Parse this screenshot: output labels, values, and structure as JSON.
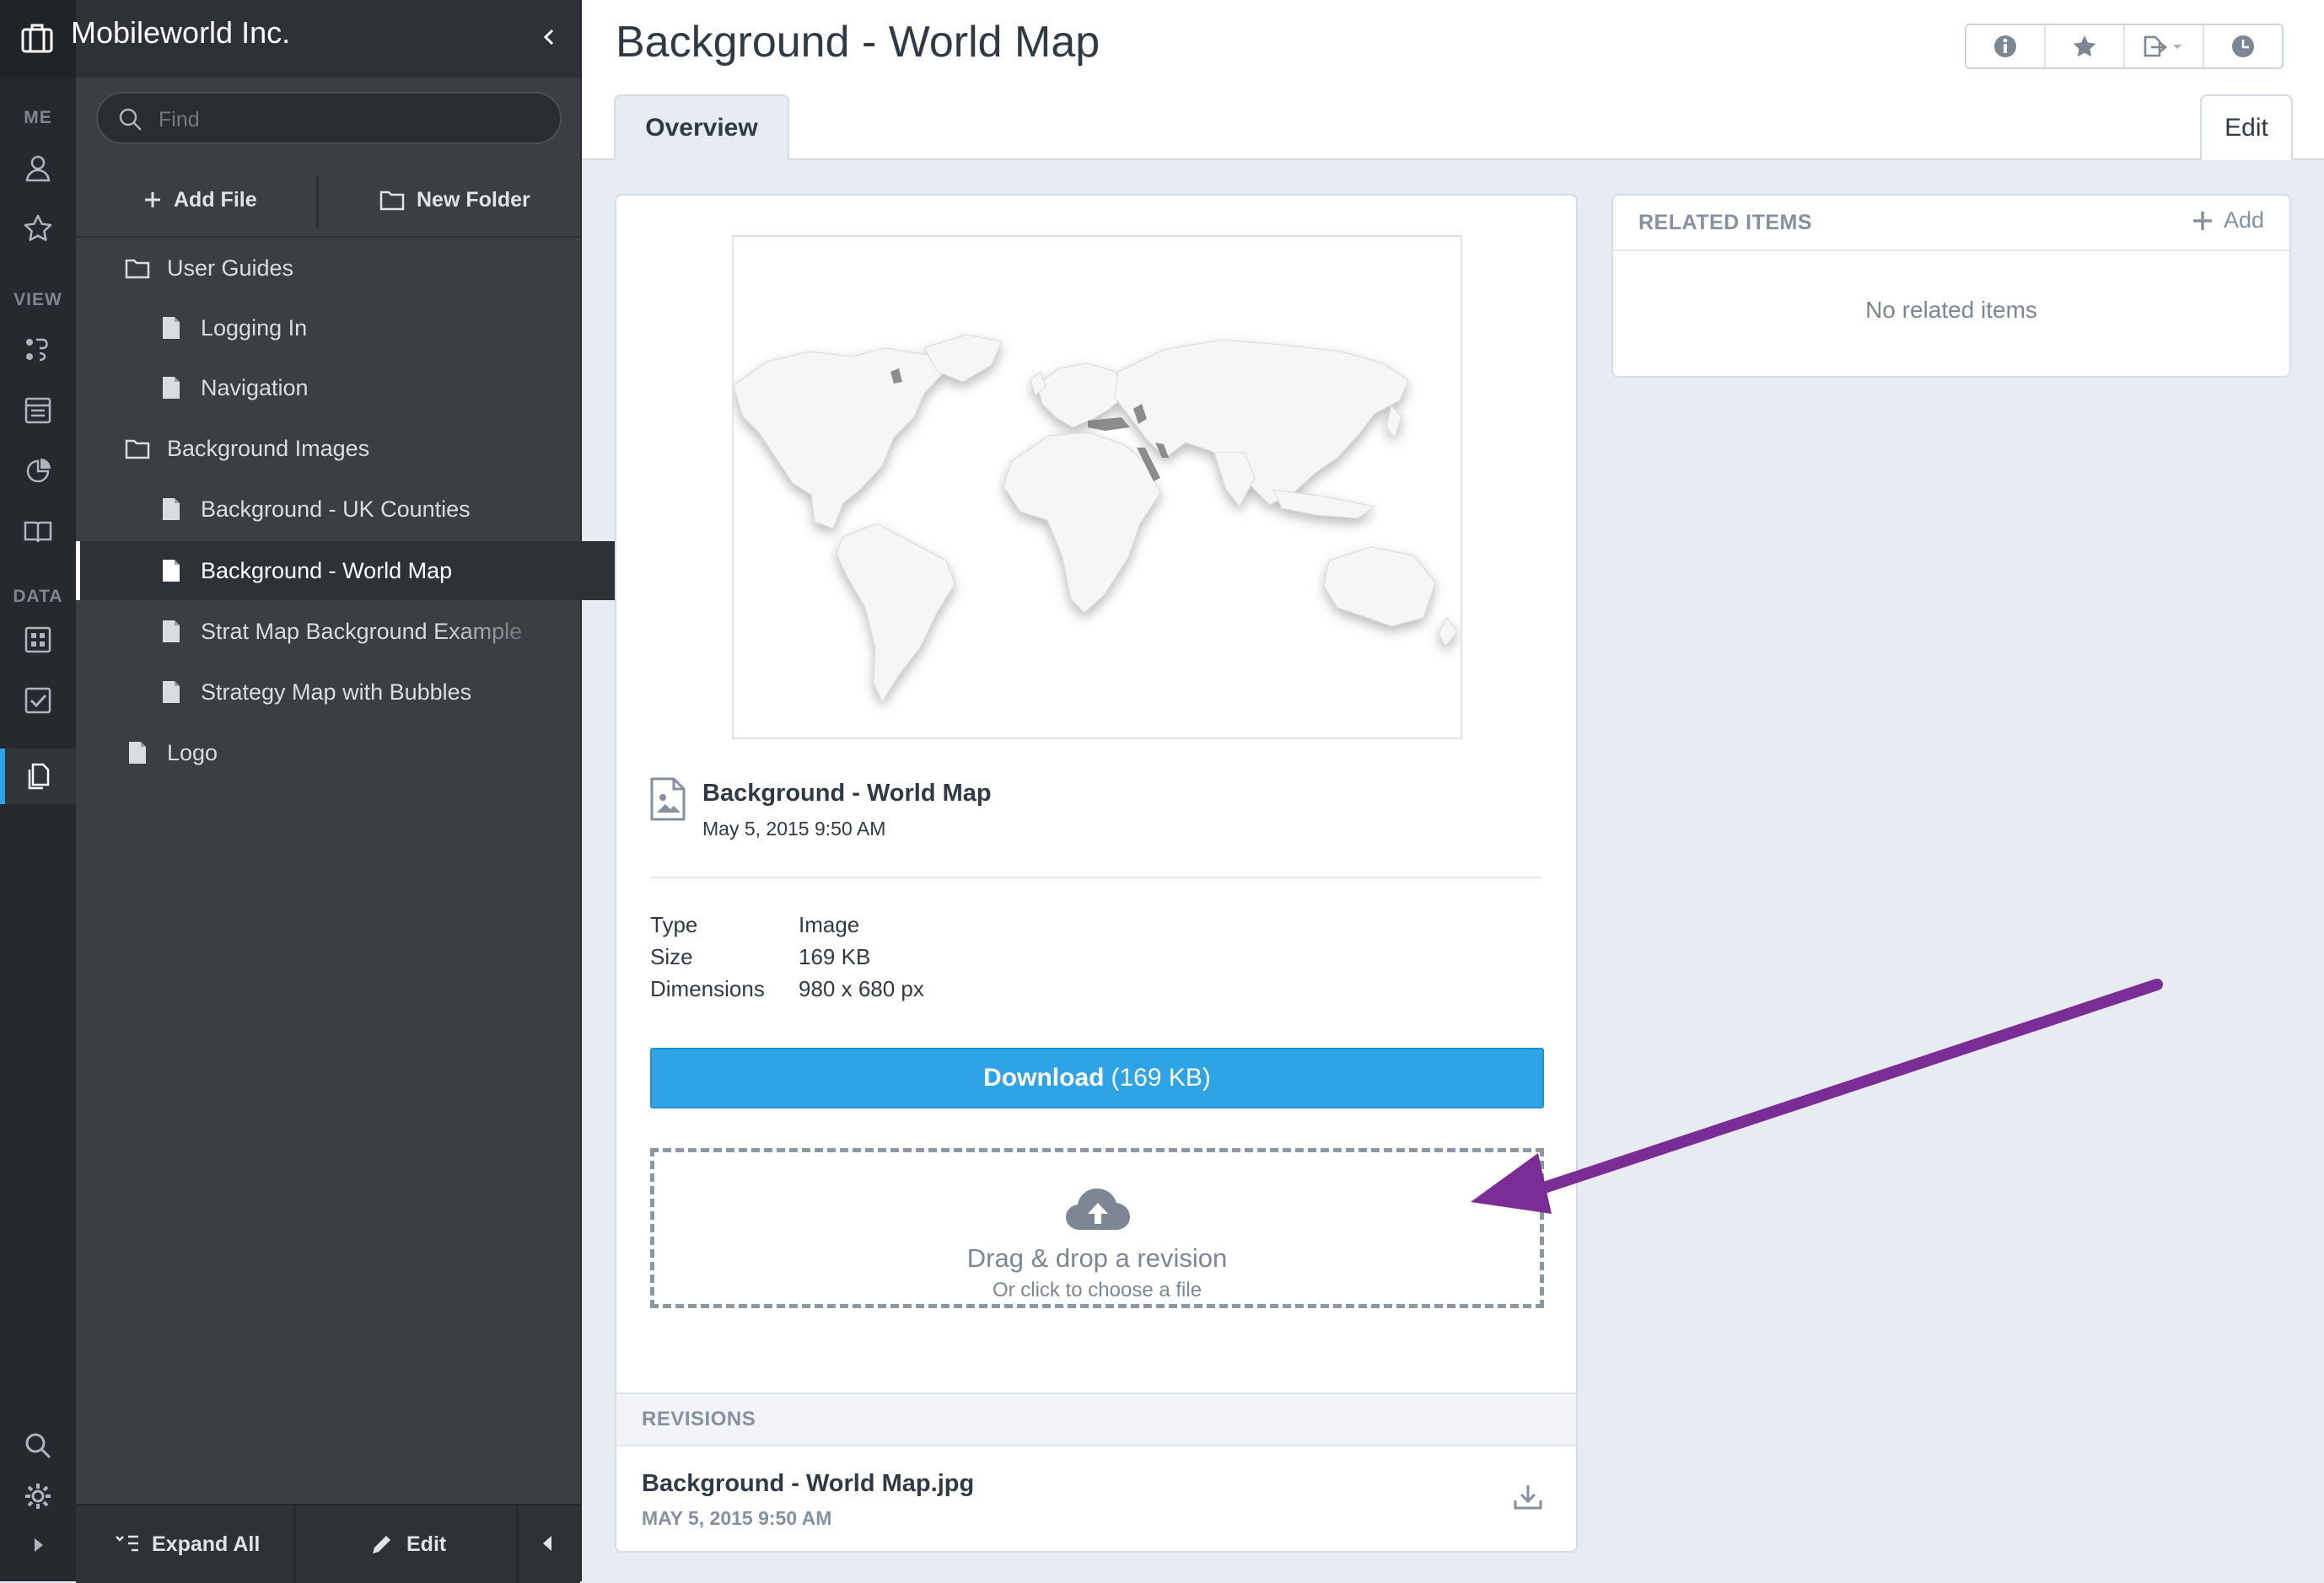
{
  "app": {
    "brand": "Mobileworld Inc."
  },
  "rail": {
    "sections": {
      "me": "ME",
      "view": "VIEW",
      "data": "DATA"
    }
  },
  "panel": {
    "search_placeholder": "Find",
    "add_file_label": "Add File",
    "new_folder_label": "New Folder",
    "tree": [
      {
        "label": "User Guides",
        "type": "folder",
        "level": 0
      },
      {
        "label": "Logging In",
        "type": "file",
        "level": 1
      },
      {
        "label": "Navigation",
        "type": "file",
        "level": 1
      },
      {
        "label": "Background Images",
        "type": "folder",
        "level": 0
      },
      {
        "label": "Background - UK Counties",
        "type": "file",
        "level": 1
      },
      {
        "label": "Background - World Map",
        "type": "file",
        "level": 1,
        "selected": true
      },
      {
        "label": "Strat Map Background Example",
        "type": "file",
        "level": 1
      },
      {
        "label": "Strategy Map with Bubbles",
        "type": "file",
        "level": 1
      },
      {
        "label": "Logo",
        "type": "file",
        "level": 0
      }
    ],
    "footer": {
      "expand_all_label": "Expand All",
      "edit_label": "Edit"
    }
  },
  "page": {
    "title": "Background - World Map",
    "tabs": {
      "overview": "Overview",
      "edit": "Edit"
    }
  },
  "file": {
    "name": "Background - World Map",
    "date": "May 5, 2015 9:50 AM",
    "props": [
      {
        "key": "Type",
        "value": "Image"
      },
      {
        "key": "Size",
        "value": "169 KB"
      },
      {
        "key": "Dimensions",
        "value": "980 x 680 px"
      }
    ],
    "download_label": "Download",
    "download_size": "(169 KB)",
    "dropzone": {
      "main": "Drag & drop a revision",
      "sub": "Or click to choose a file"
    },
    "revisions": {
      "title": "REVISIONS",
      "items": [
        {
          "name": "Background - World Map.jpg",
          "date": "MAY 5, 2015 9:50 AM"
        }
      ]
    }
  },
  "related": {
    "title": "RELATED ITEMS",
    "add_label": "Add",
    "empty_text": "No related items"
  },
  "colors": {
    "accent": "#2ea3e6",
    "annotation_arrow": "#7b2d96",
    "rail_bg": "#262a2e",
    "panel_bg": "#3b3f43"
  }
}
